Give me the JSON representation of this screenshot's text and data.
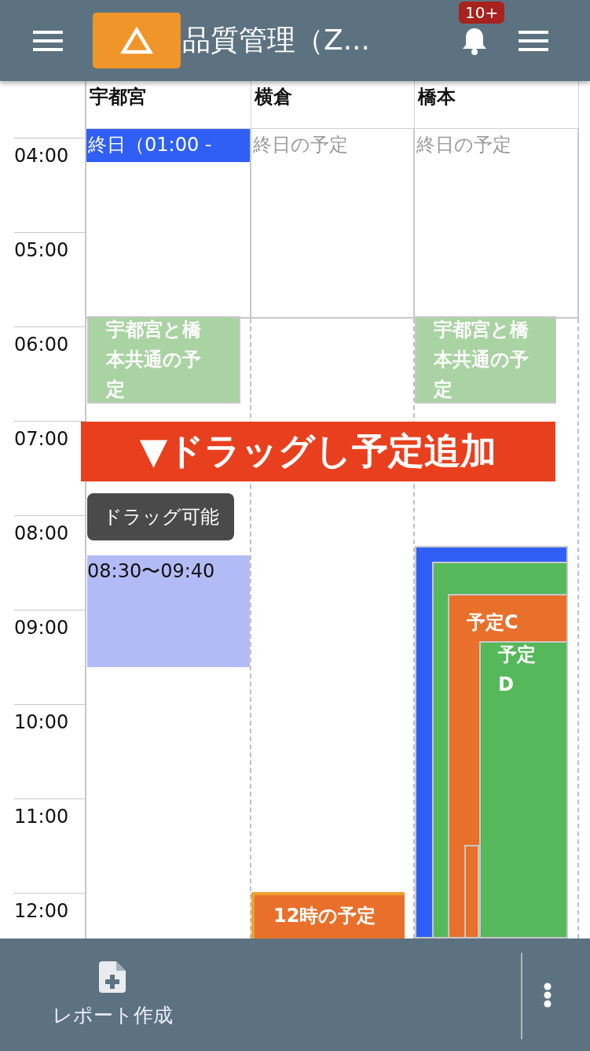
{
  "header": {
    "title": "品質管理（Z...",
    "badge": "10+"
  },
  "columns": [
    {
      "name": "宇都宮",
      "all_day": {
        "kind": "event",
        "text": "終日（01:00 -"
      }
    },
    {
      "name": "横倉",
      "all_day": {
        "kind": "empty",
        "text": "終日の予定"
      }
    },
    {
      "name": "橋本",
      "all_day": {
        "kind": "empty",
        "text": "終日の予定"
      }
    }
  ],
  "times": [
    "04:00",
    "05:00",
    "06:00",
    "07:00",
    "08:00",
    "09:00",
    "10:00",
    "11:00",
    "12:00"
  ],
  "events": [
    {
      "text": "宇都宮と橋本共通の予定",
      "color": "#a9d3a2"
    },
    {
      "text": "宇都宮と橋本共通の予定",
      "color": "#a9d3a2"
    },
    {
      "text": "08:30〜09:40",
      "color": "#b3bbf7"
    },
    {
      "text": "12時の予定",
      "color": "#e8702a"
    },
    {
      "color": "#2f5ff5"
    },
    {
      "color": "#55b85a"
    },
    {
      "text": "予定C",
      "color": "#e8702a"
    },
    {
      "color": "#e8702a"
    },
    {
      "text": "予定D",
      "color": "#55b85a"
    }
  ],
  "drag_banner": "▼ドラッグし予定追加",
  "tooltip": "ドラッグ可能",
  "footer": {
    "action": "レポート作成"
  }
}
